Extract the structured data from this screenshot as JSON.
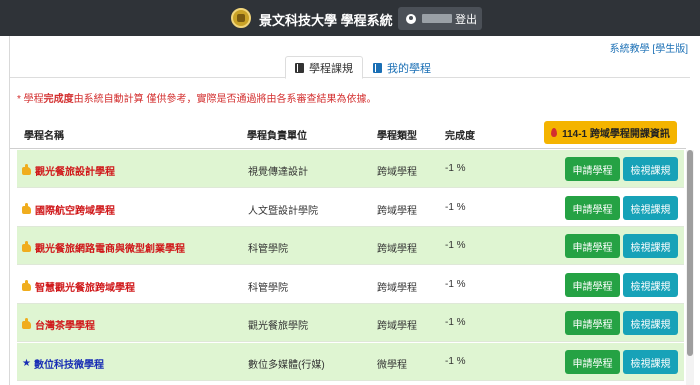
{
  "header": {
    "title": "景文科技大學 學程系統",
    "logout_label": "登出"
  },
  "system_link": "系統教學 [學生版]",
  "tabs": [
    {
      "label": "學程課規",
      "active": true
    },
    {
      "label": "我的學程",
      "active": false
    }
  ],
  "notice": {
    "prefix": "* 學程",
    "emphasis": "完成度",
    "suffix": "由系統自動計算 僅供參考，實際是否通過將由各系審查結果為依據。"
  },
  "table": {
    "columns": [
      "學程名稱",
      "學程負責單位",
      "學程類型",
      "完成度"
    ],
    "fire_button_label": "114-1 跨域學程開課資訊",
    "apply_label": "申請學程",
    "view_label": "檢視課規",
    "rows": [
      {
        "name": "觀光餐旅設計學程",
        "unit": "視覺傳達設計",
        "type": "跨域學程",
        "completion": "-1 %",
        "icon": "thumbs-up-icon",
        "style": "green"
      },
      {
        "name": "國際航空跨域學程",
        "unit": "人文暨設計學院",
        "type": "跨域學程",
        "completion": "-1 %",
        "icon": "thumbs-up-icon",
        "style": "white"
      },
      {
        "name": "觀光餐旅網路電商與微型創業學程",
        "unit": "科管學院",
        "type": "跨域學程",
        "completion": "-1 %",
        "icon": "thumbs-up-icon",
        "style": "green"
      },
      {
        "name": "智慧觀光餐旅跨域學程",
        "unit": "科管學院",
        "type": "跨域學程",
        "completion": "-1 %",
        "icon": "thumbs-up-icon",
        "style": "white"
      },
      {
        "name": "台灣茶學學程",
        "unit": "觀光餐旅學院",
        "type": "跨域學程",
        "completion": "-1 %",
        "icon": "thumbs-up-icon",
        "style": "green"
      },
      {
        "name": "數位科技微學程",
        "unit": "數位多媒體(行媒)",
        "type": "微學程",
        "completion": "-1 %",
        "icon": "star-icon",
        "style": "green"
      }
    ]
  },
  "colors": {
    "topbar": "#2f3338",
    "row_green": "#dff5d2",
    "apply_button": "#25a244",
    "view_button": "#17a2b8",
    "fire_button": "#f4b400",
    "name_red": "#d0191b",
    "name_blue": "#1a2fb5"
  }
}
